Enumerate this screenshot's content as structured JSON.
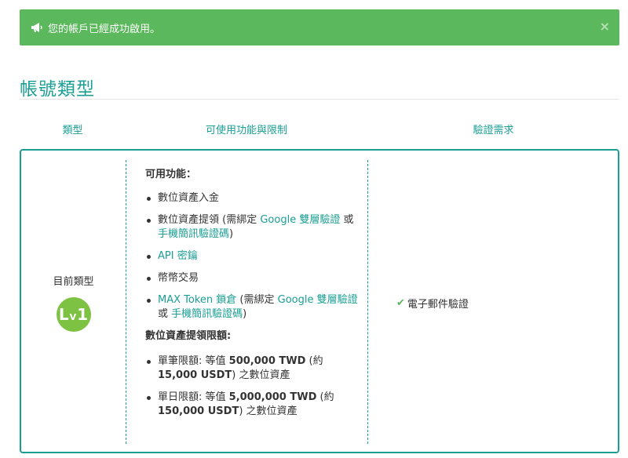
{
  "alert": {
    "message": "您的帳戶已經成功啟用。",
    "close_label": "×",
    "icon": "megaphone-icon",
    "color": "#5cb85c"
  },
  "page": {
    "title": "帳號類型",
    "accent": "#1a9e94"
  },
  "table": {
    "headers": {
      "type": "類型",
      "features": "可使用功能與限制",
      "verification": "驗證需求"
    }
  },
  "row": {
    "type_label": "目前類型",
    "badge": {
      "main": "L",
      "sub": "V",
      "level": "1",
      "color": "#7dc243"
    },
    "features_title": "可用功能：",
    "features": {
      "deposit": "數位資產入金",
      "withdraw": {
        "prefix": "數位資產提領 (需綁定 ",
        "link1": "Google 雙層驗證",
        "mid": " 或 ",
        "link2": "手機簡訊驗證碼",
        "suffix": ")"
      },
      "api": "API 密鑰",
      "trade": "幣幣交易",
      "max_lock": {
        "link0": "MAX Token 鎖倉",
        "prefix": " (需綁定 ",
        "link1": "Google 雙層驗證",
        "mid": " 或 ",
        "link2": "手機簡訊驗證碼",
        "suffix": ")"
      }
    },
    "limits_title": "數位資產提領限額:",
    "limits": {
      "single": {
        "prefix": "單筆限額: 等值 ",
        "amount": "500,000 TWD",
        "mid": " (約 ",
        "approx": "15,000 USDT",
        "suffix": ") 之數位資產"
      },
      "daily": {
        "prefix": "單日限額: 等值 ",
        "amount": "5,000,000 TWD",
        "mid": " (約 ",
        "approx": "150,000 USDT",
        "suffix": ") 之數位資產"
      }
    },
    "verification": {
      "check": "✔",
      "label": "電子郵件驗證"
    }
  }
}
